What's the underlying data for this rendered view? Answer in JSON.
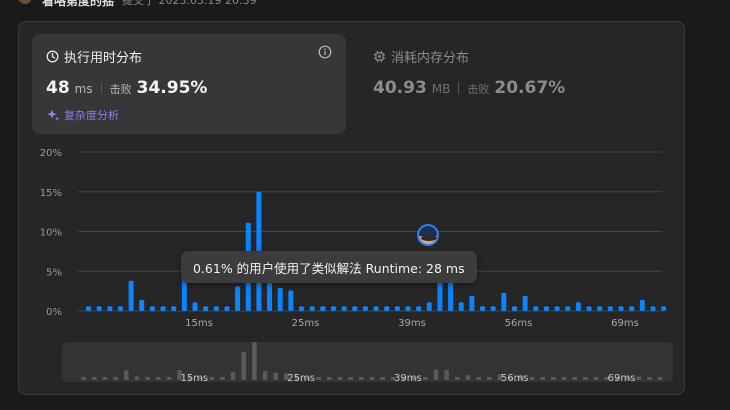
{
  "top": {
    "user": "看咯第度的揺",
    "meta": "提交于 2023.03.19 20:39"
  },
  "runtime": {
    "title": "执行用时分布",
    "value": "48",
    "unit": "ms",
    "beat_label": "击败",
    "beat_value": "34.95%",
    "link": "复杂度分析"
  },
  "memory": {
    "title": "消耗内存分布",
    "value": "40.93",
    "unit": "MB",
    "beat_label": "击败",
    "beat_value": "20.67%"
  },
  "tooltip": "0.61% 的用户使用了类似解法 Runtime: 28 ms",
  "colors": {
    "bar": "#0a84ff",
    "mini_bar": "#5a5a5a",
    "accent": "#8b7ff0"
  },
  "chart_data": {
    "type": "bar",
    "ylim": [
      0,
      20
    ],
    "y_ticks": [
      "20%",
      "15%",
      "10%",
      "5%",
      "0%"
    ],
    "x_ticks": [
      "15ms",
      "25ms",
      "39ms",
      "56ms",
      "69ms"
    ],
    "values": [
      0.6,
      0.6,
      0.6,
      0.6,
      3.8,
      1.4,
      0.6,
      0.6,
      0.6,
      3.9,
      1.1,
      0.6,
      0.6,
      0.6,
      3.1,
      11.1,
      15.0,
      3.5,
      2.9,
      2.6,
      0.6,
      0.6,
      0.6,
      0.6,
      0.6,
      0.6,
      0.6,
      0.6,
      0.6,
      0.6,
      0.6,
      0.6,
      1.1,
      4.1,
      3.9,
      1.1,
      1.9,
      0.6,
      0.6,
      2.3,
      0.6,
      1.9,
      0.6,
      0.6,
      0.6,
      0.6,
      1.1,
      0.6,
      0.6,
      0.6,
      0.6,
      0.6,
      1.4,
      0.6,
      0.6
    ]
  }
}
